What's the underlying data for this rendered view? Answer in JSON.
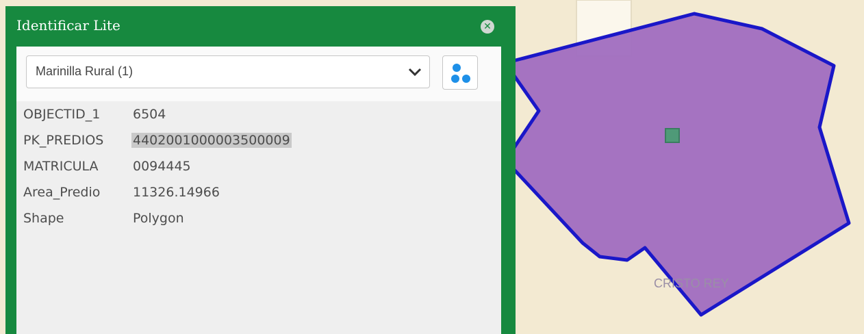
{
  "panel": {
    "title": "Identificar Lite",
    "close_icon": "close-icon"
  },
  "layer_select": {
    "selected": "Marinilla Rural (1)"
  },
  "cluster_button_icon": "cluster-icon",
  "attributes": [
    {
      "name": "OBJECTID_1",
      "value": "6504",
      "highlighted": false
    },
    {
      "name": "PK_PREDIOS",
      "value": "4402001000003500009",
      "highlighted": true
    },
    {
      "name": "MATRICULA",
      "value": "0094445",
      "highlighted": false
    },
    {
      "name": "Area_Predio",
      "value": "11326.14966",
      "highlighted": false
    },
    {
      "name": "Shape",
      "value": "Polygon",
      "highlighted": false
    }
  ],
  "map": {
    "label": "CRISTO REY",
    "parcel_fill": "#a06dc0",
    "parcel_outline": "#1a17c8",
    "background": "#f3ead2",
    "panel_color": "#17893f"
  }
}
